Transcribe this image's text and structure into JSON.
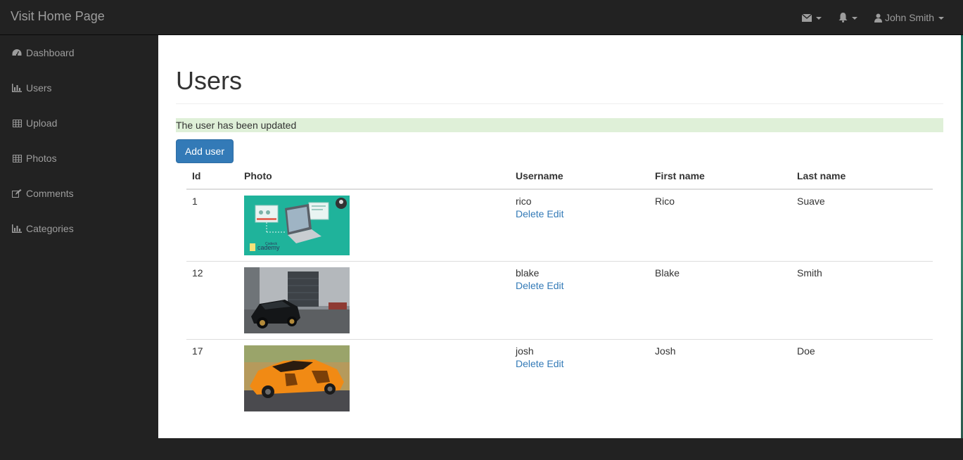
{
  "header": {
    "brand": "Visit Home Page",
    "user_name": "John Smith",
    "mail_icon": "envelope-icon",
    "bell_icon": "bell-icon",
    "user_icon": "user-icon"
  },
  "sidebar": {
    "items": [
      {
        "label": "Dashboard",
        "icon": "dashboard-icon"
      },
      {
        "label": "Users",
        "icon": "bar-chart-icon"
      },
      {
        "label": "Upload",
        "icon": "table-icon"
      },
      {
        "label": "Photos",
        "icon": "table-icon"
      },
      {
        "label": "Comments",
        "icon": "edit-icon"
      },
      {
        "label": "Categories",
        "icon": "bar-chart-icon"
      }
    ]
  },
  "main": {
    "title": "Users",
    "alert": "The user has been updated",
    "add_button": "Add user",
    "columns": [
      "Id",
      "Photo",
      "Username",
      "First name",
      "Last name"
    ],
    "rows": [
      {
        "id": "1",
        "username": "rico",
        "first": "Rico",
        "last": "Suave",
        "delete": "Delete",
        "edit": "Edit",
        "photo": "laptop-course-image"
      },
      {
        "id": "12",
        "username": "blake",
        "first": "Blake",
        "last": "Smith",
        "delete": "Delete",
        "edit": "Edit",
        "photo": "black-car-image"
      },
      {
        "id": "17",
        "username": "josh",
        "first": "Josh",
        "last": "Doe",
        "delete": "Delete",
        "edit": "Edit",
        "photo": "orange-car-image"
      }
    ],
    "thumb_text": {
      "brand_small": "Codeck",
      "brand_word": "cademy"
    }
  },
  "colors": {
    "navbar": "#222222",
    "primary": "#337ab7",
    "alert_bg": "#dff0d8",
    "link": "#337ab7"
  }
}
